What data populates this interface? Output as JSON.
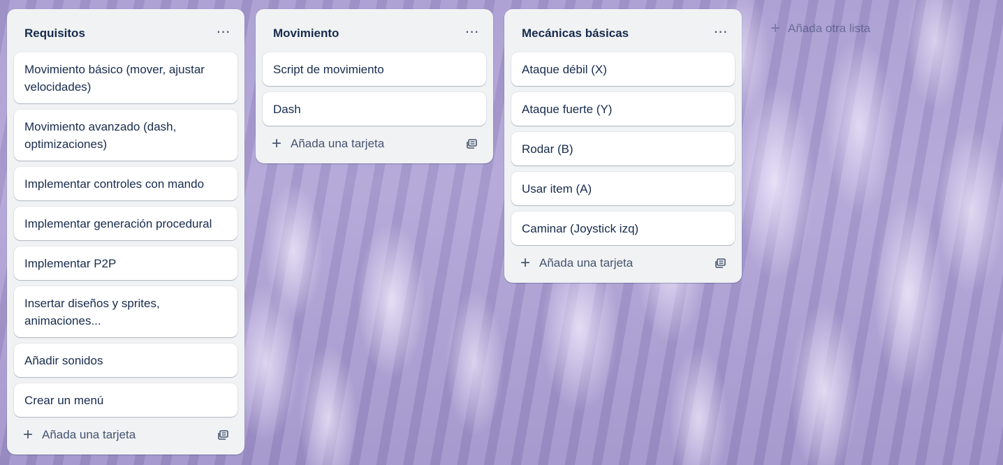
{
  "lists": [
    {
      "title": "Requisitos",
      "menu_icon": "more-horizontal-icon",
      "cards": [
        "Movimiento básico (mover, ajustar velocidades)",
        "Movimiento avanzado (dash, optimizaciones)",
        "Implementar controles con mando",
        "Implementar generación procedural",
        "Implementar P2P",
        "Insertar diseños y sprites, animaciones...",
        "Añadir sonidos",
        "Crear un menú"
      ],
      "add_card_label": "Añada una tarjeta"
    },
    {
      "title": "Movimiento",
      "menu_icon": "more-horizontal-icon",
      "cards": [
        "Script de movimiento",
        "Dash"
      ],
      "add_card_label": "Añada una tarjeta"
    },
    {
      "title": "Mecánicas básicas",
      "menu_icon": "more-horizontal-icon",
      "cards": [
        "Ataque débil (X)",
        "Ataque fuerte (Y)",
        "Rodar (B)",
        "Usar item (A)",
        "Caminar (Joystick izq)"
      ],
      "add_card_label": "Añada una tarjeta"
    }
  ],
  "add_list_label": "Añada otra lista",
  "colors": {
    "list_bg": "#f1f2f4",
    "card_bg": "#ffffff",
    "text": "#172b4d",
    "muted": "#44546f"
  }
}
